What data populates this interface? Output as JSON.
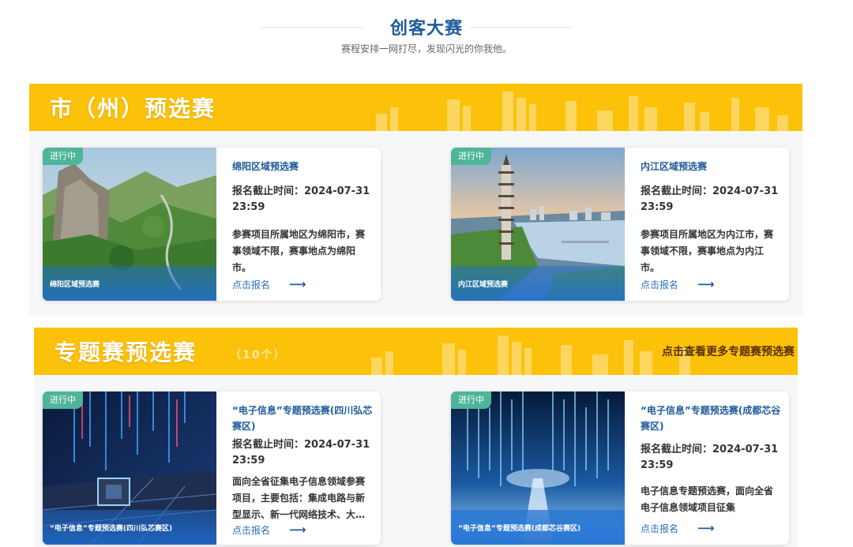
{
  "header": {
    "title": "创客大赛",
    "subtitle": "赛程安排一网打尽，发现闪光的你我他。"
  },
  "sections": [
    {
      "title": "市（州）预选赛",
      "cards": [
        {
          "status": "进行中",
          "image_caption": "绵阳区域预选赛",
          "title": "绵阳区域预选赛",
          "deadline_line1": "报名截止时间：2024-07-31",
          "deadline_line2": "23:59",
          "desc": "参赛项目所属地区为绵阳市，赛事领域不限，赛事地点为绵阳市。",
          "cta": "点击报名",
          "arrow": "⟶"
        },
        {
          "status": "进行中",
          "image_caption": "内江区域预选赛",
          "title": "内江区域预选赛",
          "deadline_line1": "报名截止时间：2024-07-31",
          "deadline_line2": "23:59",
          "desc": "参赛项目所属地区为内江市，赛事领域不限，赛事地点为内江市。",
          "cta": "点击报名",
          "arrow": "⟶"
        }
      ]
    },
    {
      "title": "专题赛预选赛",
      "count": "（10个）",
      "more_link": "点击查看更多专题赛预选赛",
      "cards": [
        {
          "status": "进行中",
          "image_caption": "“电子信息”专题预选赛(四川弘芯赛区)",
          "title": "“电子信息”专题预选赛(四川弘芯赛区)",
          "deadline_line1": "报名截止时间：2024-07-31",
          "deadline_line2": "23:59",
          "desc": "面向全省征集电子信息领域参赛项目，主要包括：集成电路与新型显示、新一代网络技术、大数据",
          "cta": "点击报名",
          "arrow": "⟶"
        },
        {
          "status": "进行中",
          "image_caption": "“电子信息”专题预选赛(成都芯谷赛区)",
          "title": "“电子信息”专题预选赛(成都芯谷赛区)",
          "deadline_line1": "报名截止时间：2024-07-31",
          "deadline_line2": "23:59",
          "desc": "电子信息专题预选赛，面向全省电子信息领域项目征集",
          "cta": "点击报名",
          "arrow": "⟶"
        }
      ]
    }
  ]
}
